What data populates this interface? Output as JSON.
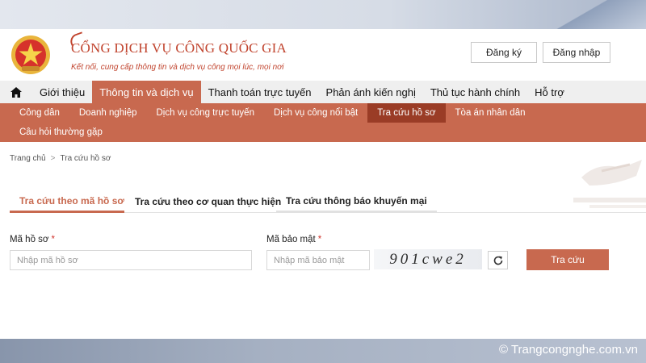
{
  "header": {
    "title": "CỔNG DỊCH VỤ CÔNG QUỐC GIA",
    "subtitle": "Kết nối, cung cấp thông tin và dịch vụ công mọi lúc, mọi nơi",
    "register_label": "Đăng ký",
    "login_label": "Đăng nhập"
  },
  "mainnav": {
    "items": [
      {
        "label": "Giới thiệu"
      },
      {
        "label": "Thông tin và dịch vụ"
      },
      {
        "label": "Thanh toán trực tuyến"
      },
      {
        "label": "Phản ánh kiến nghị"
      },
      {
        "label": "Thủ tục hành chính"
      },
      {
        "label": "Hỗ trợ"
      }
    ],
    "active": "Thông tin và dịch vụ"
  },
  "subnav": {
    "items": [
      {
        "label": "Công dân"
      },
      {
        "label": "Doanh nghiệp"
      },
      {
        "label": "Dịch vụ công trực tuyến"
      },
      {
        "label": "Dịch vụ công nổi bật"
      },
      {
        "label": "Tra cứu hồ sơ"
      },
      {
        "label": "Tòa án nhân dân"
      },
      {
        "label": "Câu hỏi thường gặp"
      }
    ],
    "active": "Tra cứu hồ sơ"
  },
  "breadcrumb": {
    "home": "Trang chủ",
    "separator": ">",
    "current": "Tra cứu hồ sơ"
  },
  "tabs": [
    {
      "label": "Tra cứu theo mã hồ sơ"
    },
    {
      "label": "Tra cứu theo cơ quan thực hiện"
    },
    {
      "label": "Tra cứu thông báo khuyến mại"
    }
  ],
  "form": {
    "file_code_label": "Mã hồ sơ",
    "file_code_placeholder": "Nhập mã hồ sơ",
    "security_code_label": "Mã bảo mật",
    "security_code_placeholder": "Nhập mã bảo mật",
    "required_mark": "*",
    "captcha_text": "901cwe2",
    "search_label": "Tra cứu"
  },
  "watermark": "© Trangcongnghe.com.vn",
  "colors": {
    "accent": "#c8694f",
    "accent_dark": "#9a3c26",
    "brand": "#c1442e",
    "required": "#d0342c"
  },
  "icons": {
    "home": "home-icon",
    "refresh": "refresh-icon",
    "emblem": "national-emblem-icon"
  }
}
